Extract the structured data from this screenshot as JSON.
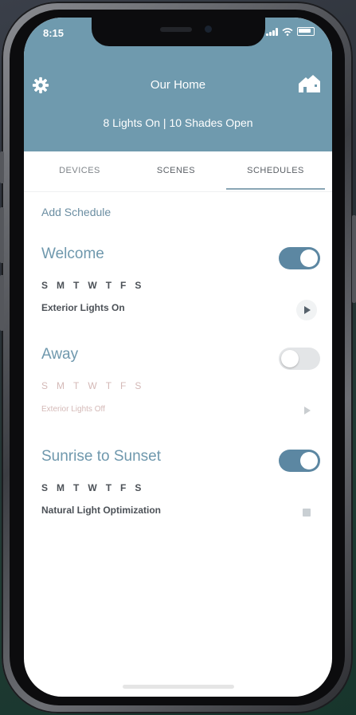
{
  "status_bar": {
    "time": "8:15"
  },
  "header": {
    "title": "Our Home",
    "summary": "8 Lights On  |  10 Shades Open",
    "settings_icon": "gear-icon",
    "home_icon": "house-icon"
  },
  "tabs": [
    {
      "label": "DEVICES",
      "active": false
    },
    {
      "label": "SCENES",
      "active": false
    },
    {
      "label": "SCHEDULES",
      "active": true
    }
  ],
  "add_schedule": "Add Schedule",
  "schedules": [
    {
      "name": "Welcome",
      "enabled": true,
      "days": [
        "S",
        "M",
        "T",
        "W",
        "T",
        "F",
        "S"
      ],
      "action": "Exterior Lights On",
      "control": "play-icon"
    },
    {
      "name": "Away",
      "enabled": false,
      "days": [
        "S",
        "M",
        "T",
        "W",
        "T",
        "F",
        "S"
      ],
      "action": "Exterior Lights Off",
      "control": "play-icon"
    },
    {
      "name": "Sunrise to Sunset",
      "enabled": true,
      "days": [
        "S",
        "M",
        "T",
        "W",
        "T",
        "F",
        "S"
      ],
      "action": "Natural Light Optimization",
      "control": "stop-icon"
    }
  ],
  "colors": {
    "header": "#6f9aae",
    "accent": "#5c87a2",
    "title_blue": "#6f98ad"
  }
}
